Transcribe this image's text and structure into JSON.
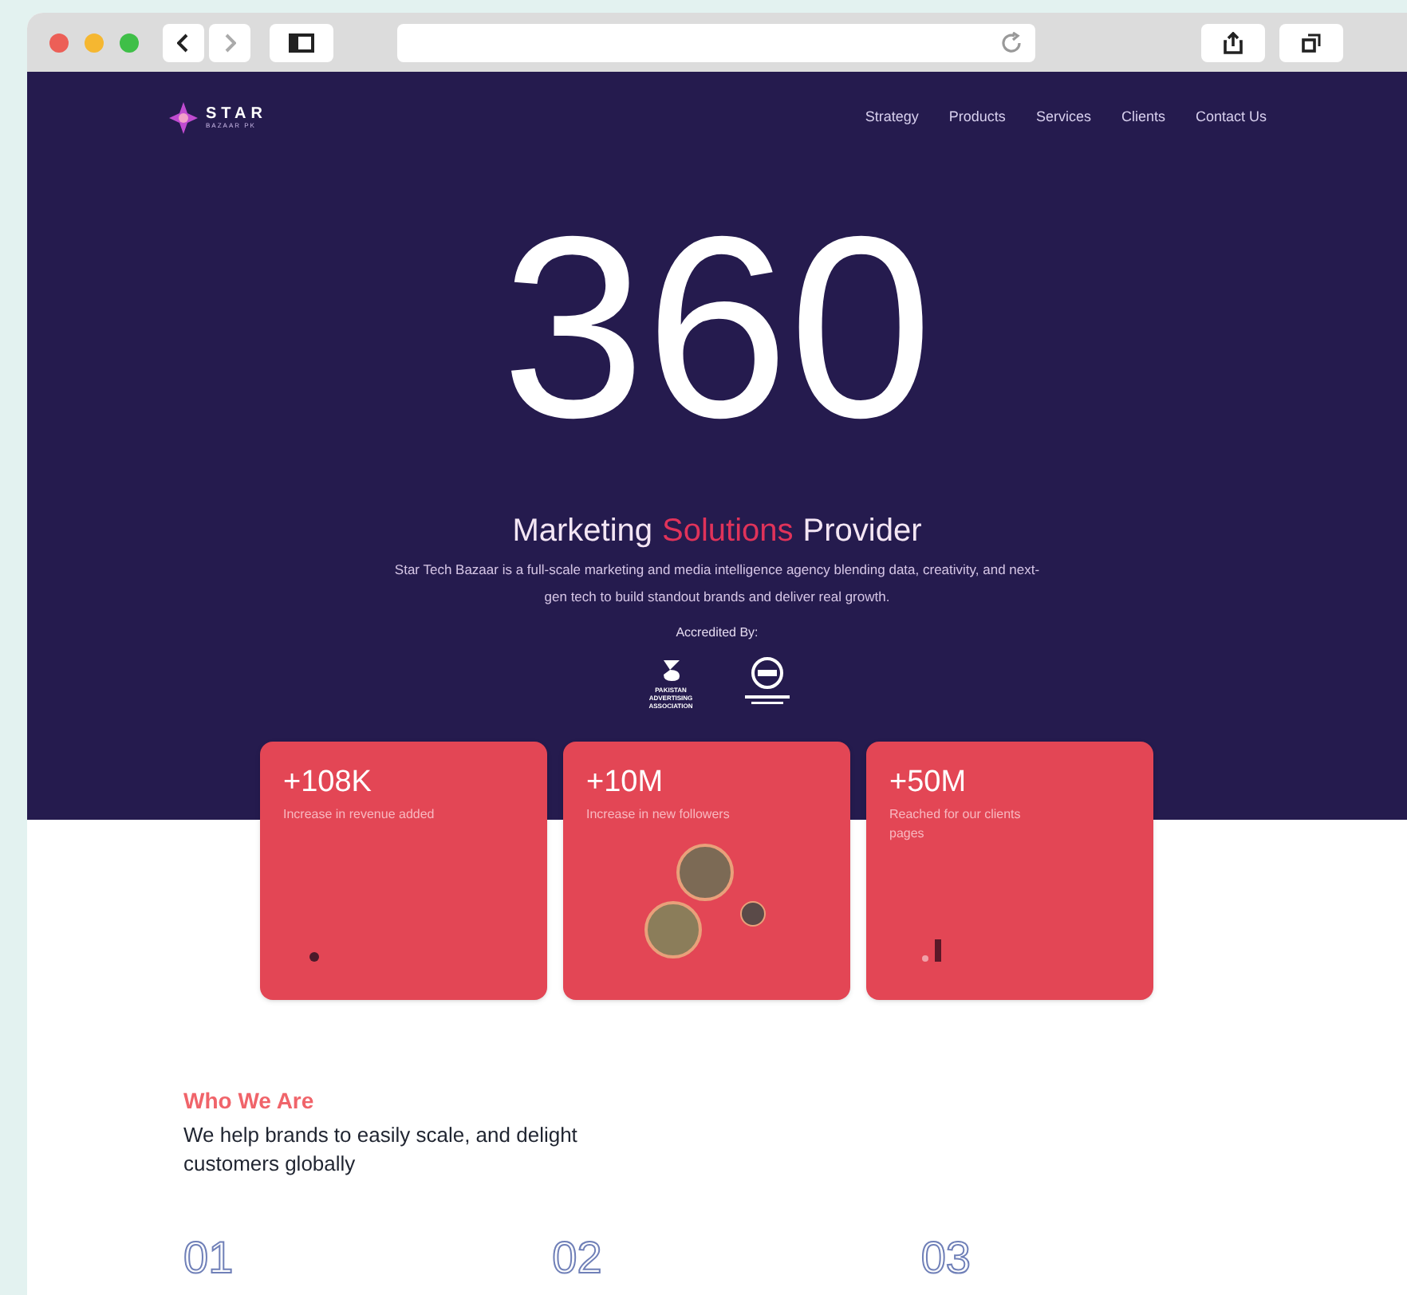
{
  "logo": {
    "name": "STAR",
    "tagline": "BAZAAR PK"
  },
  "nav": [
    "Strategy",
    "Products",
    "Services",
    "Clients",
    "Contact Us"
  ],
  "hero": {
    "headline": "360",
    "title_parts": [
      {
        "text": "Marketing",
        "accent": false
      },
      {
        "text": "Solutions",
        "accent": true
      },
      {
        "text": "Provider",
        "accent": false
      }
    ],
    "description": "Star Tech Bazaar is a full-scale marketing and media intelligence agency blending data, creativity, and next-gen tech to build standout brands and deliver real growth.",
    "accredited_label": "Accredited By:",
    "accreditations": [
      {
        "kind": "paa",
        "text": "PAKISTAN ADVERTISING ASSOCIATION"
      },
      {
        "kind": "seal"
      }
    ]
  },
  "stats": [
    {
      "value": "+108K",
      "caption": "Increase in revenue added",
      "kind": "dot"
    },
    {
      "value": "+10M",
      "caption": "Increase in new followers",
      "kind": "avatars"
    },
    {
      "value": "+50M",
      "caption": "Reached for our clients pages",
      "kind": "bar"
    }
  ],
  "about": {
    "eyebrow": "Who We Are",
    "heading": "We help brands to easily scale, and delight customers globally"
  },
  "steps": [
    "01",
    "02",
    "03"
  ]
}
